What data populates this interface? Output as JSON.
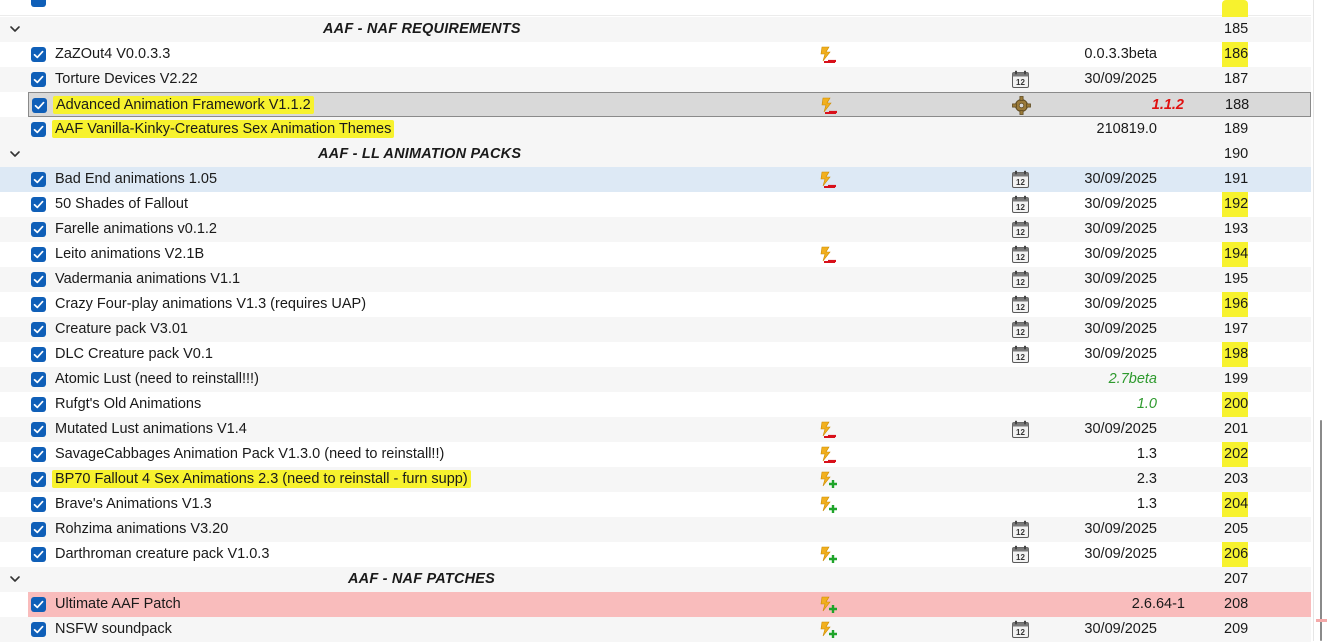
{
  "colors": {
    "highlight": "#f7f22e",
    "checkbox": "#0f5fb8",
    "separator_bg": "#f6f6f6",
    "selected_bg": "#d9d9d9",
    "hover_bg": "#dde9f5",
    "conflict_bg": "#f9bcbc",
    "green_version": "#2e9a2e",
    "red_version": "#e01010"
  },
  "icons": {
    "flag_conflict_minus": "lightning-minus-icon",
    "flag_conflict_plus": "lightning-plus-icon",
    "calendar": "calendar-icon",
    "gear": "gear-icon",
    "expand": "chevron-down-icon",
    "checkbox": "checkbox-checked-icon"
  },
  "rows": [
    {
      "kind": "separator",
      "name": "AAF - NAF REQUIREMENTS",
      "priority": "185"
    },
    {
      "kind": "mod",
      "name": "ZaZOut4 V0.0.3.3",
      "flag": "minus",
      "date_icon": "",
      "version": "0.0.3.3beta",
      "version_style": "",
      "priority": "186",
      "highlight": false,
      "state": ""
    },
    {
      "kind": "mod",
      "name": "Torture Devices V2.22",
      "flag": "",
      "date_icon": "calendar",
      "version": "30/09/2025",
      "version_style": "",
      "priority": "187",
      "highlight": false,
      "state": ""
    },
    {
      "kind": "mod",
      "name": "Advanced Animation Framework V1.1.2",
      "flag": "minus",
      "date_icon": "gear",
      "version": "1.1.2",
      "version_style": "red",
      "priority": "188",
      "highlight": true,
      "state": "selected"
    },
    {
      "kind": "mod",
      "name": "AAF Vanilla-Kinky-Creatures Sex Animation Themes",
      "flag": "",
      "date_icon": "",
      "version": "210819.0",
      "version_style": "",
      "priority": "189",
      "highlight": true,
      "state": ""
    },
    {
      "kind": "separator",
      "name": "AAF - LL ANIMATION PACKS",
      "priority": "190"
    },
    {
      "kind": "mod",
      "name": "Bad End animations 1.05",
      "flag": "minus",
      "date_icon": "calendar",
      "version": "30/09/2025",
      "version_style": "",
      "priority": "191",
      "highlight": false,
      "state": "hover"
    },
    {
      "kind": "mod",
      "name": "50 Shades of Fallout",
      "flag": "",
      "date_icon": "calendar",
      "version": "30/09/2025",
      "version_style": "",
      "priority": "192",
      "highlight": false,
      "state": ""
    },
    {
      "kind": "mod",
      "name": "Farelle animations v0.1.2",
      "flag": "",
      "date_icon": "calendar",
      "version": "30/09/2025",
      "version_style": "",
      "priority": "193",
      "highlight": false,
      "state": ""
    },
    {
      "kind": "mod",
      "name": "Leito animations V2.1B",
      "flag": "minus",
      "date_icon": "calendar",
      "version": "30/09/2025",
      "version_style": "",
      "priority": "194",
      "highlight": false,
      "state": ""
    },
    {
      "kind": "mod",
      "name": "Vadermania animations V1.1",
      "flag": "",
      "date_icon": "calendar",
      "version": "30/09/2025",
      "version_style": "",
      "priority": "195",
      "highlight": false,
      "state": ""
    },
    {
      "kind": "mod",
      "name": "Crazy Four-play animations V1.3 (requires UAP)",
      "flag": "",
      "date_icon": "calendar",
      "version": "30/09/2025",
      "version_style": "",
      "priority": "196",
      "highlight": false,
      "state": ""
    },
    {
      "kind": "mod",
      "name": "Creature pack V3.01",
      "flag": "",
      "date_icon": "calendar",
      "version": "30/09/2025",
      "version_style": "",
      "priority": "197",
      "highlight": false,
      "state": ""
    },
    {
      "kind": "mod",
      "name": "DLC Creature pack V0.1",
      "flag": "",
      "date_icon": "calendar",
      "version": "30/09/2025",
      "version_style": "",
      "priority": "198",
      "highlight": false,
      "state": ""
    },
    {
      "kind": "mod",
      "name": "Atomic Lust (need to reinstall!!!)",
      "flag": "",
      "date_icon": "",
      "version": "2.7beta",
      "version_style": "green",
      "priority": "199",
      "highlight": false,
      "state": ""
    },
    {
      "kind": "mod",
      "name": "Rufgt's Old Animations",
      "flag": "",
      "date_icon": "",
      "version": "1.0",
      "version_style": "green",
      "priority": "200",
      "highlight": false,
      "state": ""
    },
    {
      "kind": "mod",
      "name": "Mutated Lust animations V1.4",
      "flag": "minus",
      "date_icon": "calendar",
      "version": "30/09/2025",
      "version_style": "",
      "priority": "201",
      "highlight": false,
      "state": ""
    },
    {
      "kind": "mod",
      "name": "SavageCabbages Animation Pack V1.3.0 (need to reinstall!!)",
      "flag": "minus",
      "date_icon": "",
      "version": "1.3",
      "version_style": "",
      "priority": "202",
      "highlight": false,
      "state": ""
    },
    {
      "kind": "mod",
      "name": "BP70 Fallout 4 Sex Animations 2.3 (need to reinstall - furn supp)",
      "flag": "plus",
      "date_icon": "",
      "version": "2.3",
      "version_style": "",
      "priority": "203",
      "highlight": true,
      "state": ""
    },
    {
      "kind": "mod",
      "name": "Brave's Animations V1.3",
      "flag": "plus",
      "date_icon": "",
      "version": "1.3",
      "version_style": "",
      "priority": "204",
      "highlight": false,
      "state": ""
    },
    {
      "kind": "mod",
      "name": "Rohzima animations V3.20",
      "flag": "",
      "date_icon": "calendar",
      "version": "30/09/2025",
      "version_style": "",
      "priority": "205",
      "highlight": false,
      "state": ""
    },
    {
      "kind": "mod",
      "name": "Darthroman creature pack V1.0.3",
      "flag": "plus",
      "date_icon": "calendar",
      "version": "30/09/2025",
      "version_style": "",
      "priority": "206",
      "highlight": false,
      "state": ""
    },
    {
      "kind": "separator",
      "name": "AAF - NAF PATCHES",
      "priority": "207"
    },
    {
      "kind": "mod",
      "name": "Ultimate AAF Patch",
      "flag": "plus",
      "date_icon": "",
      "version": "2.6.64-1",
      "version_style": "",
      "priority": "208",
      "highlight": false,
      "state": "conflict"
    },
    {
      "kind": "mod",
      "name": "NSFW soundpack",
      "flag": "plus",
      "date_icon": "calendar",
      "version": "30/09/2025",
      "version_style": "",
      "priority": "209",
      "highlight": false,
      "state": ""
    }
  ]
}
